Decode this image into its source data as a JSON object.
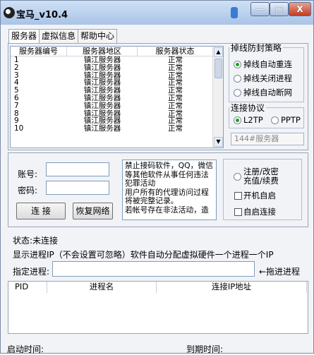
{
  "window": {
    "title": "宝马_v10.4",
    "buttons": {
      "minimize": "—",
      "maximize": "□",
      "close": "X"
    }
  },
  "tabs": [
    "服务器",
    "虚拟信息",
    "帮助中心"
  ],
  "server_list": {
    "columns": [
      "服务器编号",
      "服务器地区",
      "服务器状态"
    ],
    "rows": [
      [
        "1",
        "镇江服务器",
        "正常"
      ],
      [
        "2",
        "镇江服务器",
        "正常"
      ],
      [
        "3",
        "镇江服务器",
        "正常"
      ],
      [
        "4",
        "镇江服务器",
        "正常"
      ],
      [
        "5",
        "镇江服务器",
        "正常"
      ],
      [
        "6",
        "镇江服务器",
        "正常"
      ],
      [
        "7",
        "镇江服务器",
        "正常"
      ],
      [
        "8",
        "镇江服务器",
        "正常"
      ],
      [
        "9",
        "镇江服务器",
        "正常"
      ],
      [
        "10",
        "镇江服务器",
        "正常"
      ]
    ]
  },
  "disconnect_strategy": {
    "legend": "掉线防封策略",
    "options": [
      "掉线自动重连",
      "掉线关闭进程",
      "掉线自动断网"
    ],
    "selected_index": 0
  },
  "protocol": {
    "legend": "连接协议",
    "options": [
      "L2TP",
      "PPTP"
    ],
    "selected_index": 0
  },
  "server_field": {
    "value": "144#服务器"
  },
  "login": {
    "account_label": "账号:",
    "password_label": "密码:",
    "account_value": "",
    "password_value": "",
    "connect_button": "连 接",
    "restore_button": "恢复网络"
  },
  "notice_text": "禁止接码软件，QQ，微信等其他软件从事任何违法犯罪活动\n用户所有的代理访问过程将被完整记录。\n若帐号存在非法活动，造",
  "options_panel": {
    "register_label": "注册/改密\n充值/续费",
    "autostart_label": "开机自启",
    "autoconnect_label": "自启连接"
  },
  "status": {
    "label": "状态:",
    "value": "未连接"
  },
  "info_line": "显示进程IP（不会设置可忽略）软件自动分配虚拟硬件一个进程一个IP",
  "process": {
    "label": "指定进程:",
    "value": "",
    "drag_label": "←拖进进程"
  },
  "process_table": {
    "columns": [
      "PID",
      "进程名",
      "连接IP地址"
    ]
  },
  "footer": {
    "start_label": "启动时间:",
    "expire_label": "到期时间:"
  }
}
